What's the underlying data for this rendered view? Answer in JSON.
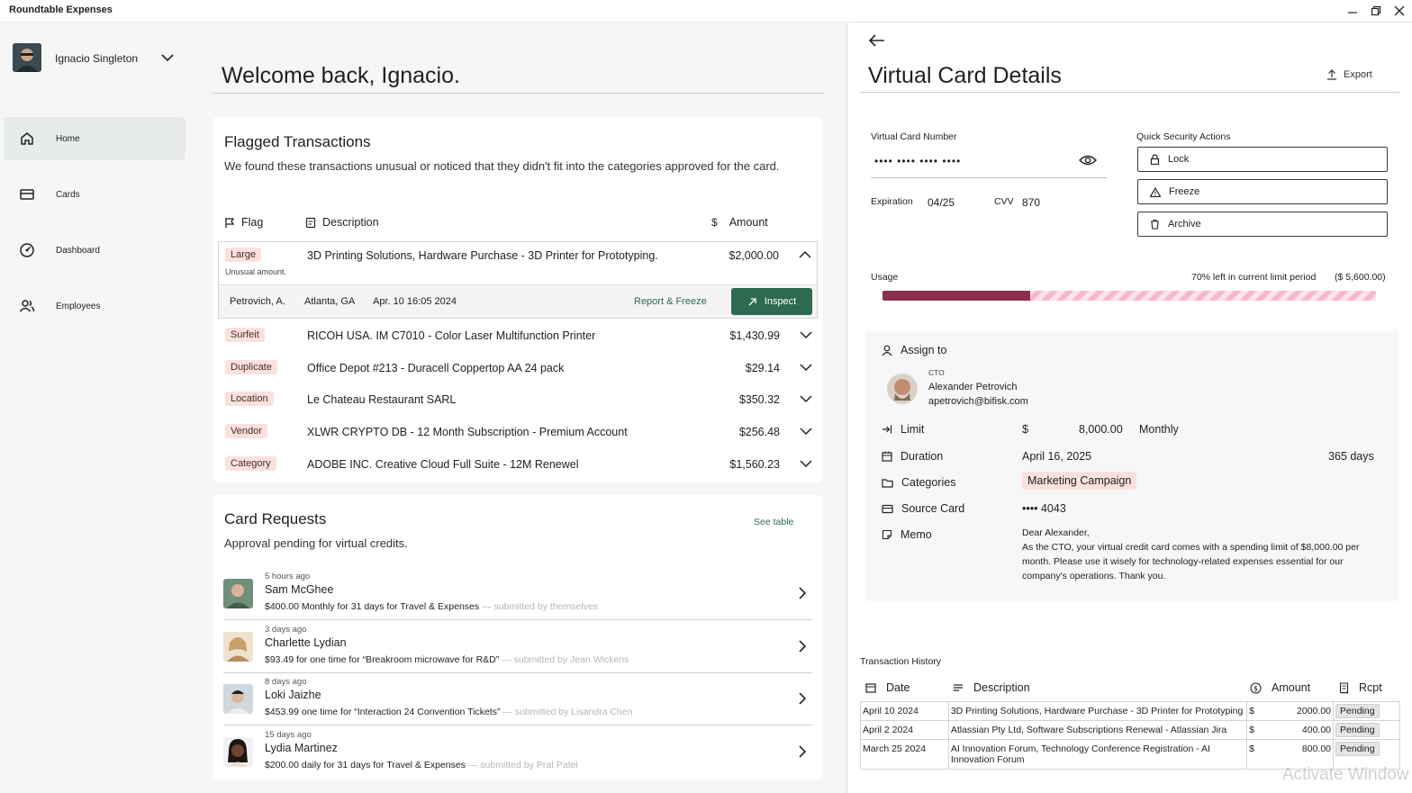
{
  "window": {
    "title": "Roundtable Expenses"
  },
  "sidebar": {
    "user_name": "Ignacio Singleton",
    "items": [
      {
        "label": "Home",
        "icon": "home-icon",
        "active": true
      },
      {
        "label": "Cards",
        "icon": "card-icon",
        "active": false
      },
      {
        "label": "Dashboard",
        "icon": "gauge-icon",
        "active": false
      },
      {
        "label": "Employees",
        "icon": "people-icon",
        "active": false
      }
    ]
  },
  "main": {
    "welcome": "Welcome back, Ignacio.",
    "flagged": {
      "title": "Flagged Transactions",
      "subtitle": "We found these transactions unusual or noticed that they didn't fit into the categories approved for the card.",
      "headers": {
        "flag": "Flag",
        "description": "Description",
        "amount": "Amount"
      },
      "expanded": {
        "flag": "Large",
        "note": "Unusual amount.",
        "description": "3D Printing Solutions, Hardware Purchase - 3D Printer for Prototyping.",
        "amount": "$2,000.00",
        "person": "Petrovich, A.",
        "location": "Atlanta, GA",
        "datetime": "Apr. 10 16:05 2024",
        "report_label": "Report & Freeze",
        "inspect_label": "Inspect"
      },
      "rows": [
        {
          "flag": "Surfeit",
          "description": "RICOH USA. IM C7010 - Color Laser Multifunction Printer",
          "amount": "$1,430.99"
        },
        {
          "flag": "Duplicate",
          "description": "Office Depot #213 - Duracell Coppertop AA 24 pack",
          "amount": "$29.14"
        },
        {
          "flag": "Location",
          "description": "Le Chateau Restaurant SARL",
          "amount": "$350.32"
        },
        {
          "flag": "Vendor",
          "description": "XLWR CRYPTO DB -  12 Month Subscription - Premium Account",
          "amount": "$256.48"
        },
        {
          "flag": "Category",
          "description": "ADOBE INC. Creative Cloud Full Suite - 12M Renewel",
          "amount": "$1,560.23"
        }
      ]
    },
    "requests": {
      "title": "Card Requests",
      "subtitle": "Approval pending for virtual credits.",
      "see_table": "See table",
      "items": [
        {
          "ago": "5 hours ago",
          "name": "Sam McGhee",
          "detail": "$400.00 Monthly for 31 days for Travel & Expenses",
          "submitted": "— submitted by themselves"
        },
        {
          "ago": "3 days ago",
          "name": "Charlette Lydian",
          "detail": "$93.49 for one time for “Breakroom microwave for R&D”",
          "submitted": "— submitted by Jean Wickens"
        },
        {
          "ago": "8 days ago",
          "name": "Loki Jaizhe",
          "detail": "$453.99 one time for “Interaction 24 Convention Tickets”",
          "submitted": "— submitted by Lisandra Chen"
        },
        {
          "ago": "15 days ago",
          "name": "Lydia Martinez",
          "detail": "$200.00 daily for 31 days for Travel & Expenses",
          "submitted": "— submitted by Prat Patel"
        }
      ]
    }
  },
  "panel": {
    "title": "Virtual Card Details",
    "export_label": "Export",
    "card_number_label": "Virtual Card Number",
    "card_number": "•••• •••• •••• ••••",
    "expiration_label": "Expiration",
    "expiration": "04/25",
    "cvv_label": "CVV",
    "cvv": "870",
    "security_title": "Quick Security Actions",
    "security_actions": [
      "Lock",
      "Freeze",
      "Archive"
    ],
    "usage_label": "Usage",
    "usage_left": "70% left in current limit period",
    "usage_amount": "($ 5,600.00)",
    "usage_used_fraction": 0.3,
    "assign_label": "Assign to",
    "assignee": {
      "role": "CTO",
      "name": "Alexander Petrovich",
      "email": "apetrovich@bifisk.com"
    },
    "limit_label": "Limit",
    "limit_currency": "$",
    "limit_value": "8,000.00",
    "limit_period": "Monthly",
    "duration_label": "Duration",
    "duration_date": "April 16, 2025",
    "duration_days": "365 days",
    "categories_label": "Categories",
    "category": "Marketing Campaign",
    "source_label": "Source Card",
    "source_card": "•••• 4043",
    "memo_label": "Memo",
    "memo_greeting": "Dear Alexander,",
    "memo_body": "As the CTO, your virtual credit card comes with a spending limit of $8,000.00 per month. Please use it wisely for technology-related expenses essential for our company's operations. Thank you.",
    "history_title": "Transaction History",
    "history_headers": {
      "date": "Date",
      "description": "Description",
      "amount": "Amount",
      "receipt": "Rcpt"
    },
    "history_rows": [
      {
        "date": "April 10 2024",
        "description": "3D Printing Solutions, Hardware Purchase - 3D Printer for Prototyping",
        "currency": "$",
        "amount": "2000.00",
        "status": "Pending"
      },
      {
        "date": "April 2 2024",
        "description": "Atlassian Pty Ltd, Software Subscriptions Renewal - Atlassian Jira",
        "currency": "$",
        "amount": "400.00",
        "status": "Pending"
      },
      {
        "date": "March 25 2024",
        "description": "AI Innovation Forum, Technology Conference Registration - AI Innovation Forum",
        "currency": "$",
        "amount": "800.00",
        "status": "Pending"
      }
    ]
  },
  "watermark": "Activate Window",
  "colors": {
    "accent": "#2d6a4f",
    "usage_fill": "#8c2f4f",
    "usage_stripe": "#f7b9c9",
    "badge": "#fbe1dd"
  }
}
